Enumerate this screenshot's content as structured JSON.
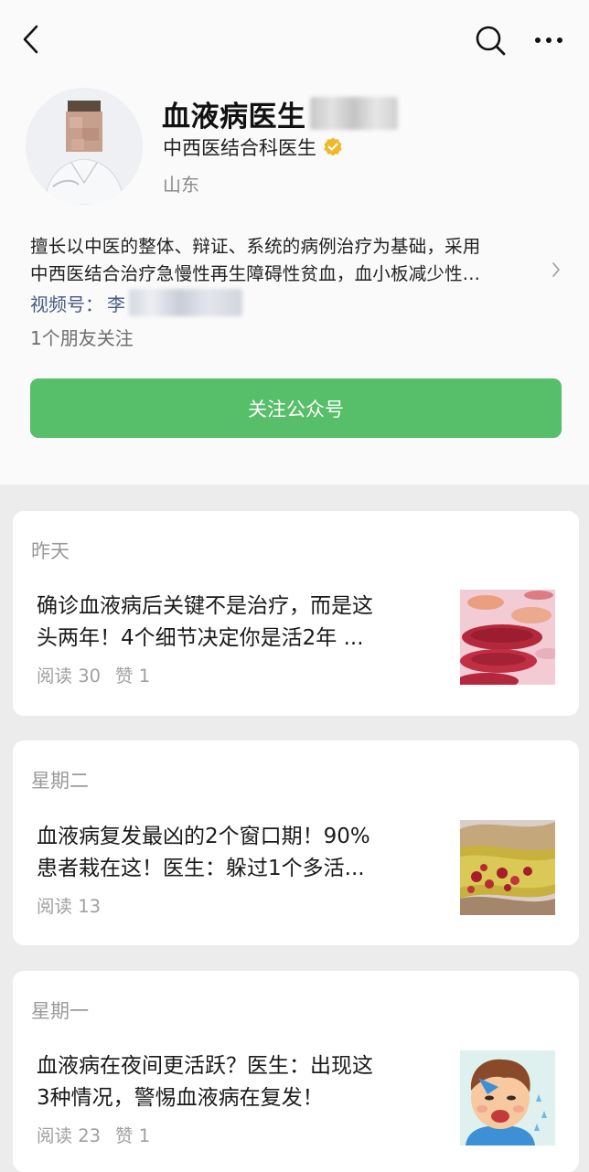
{
  "profile": {
    "name": "血液病医生",
    "verification": "中西医结合科医生",
    "location": "山东",
    "description_line1": "擅长以中医的整体、辩证、系统的病例治疗为基础，采用",
    "description_line2": "中西医结合治疗急慢性再生障碍性贫血，血小板减少性...",
    "channel_label": "视频号：",
    "channel_value": "李",
    "friends_following": "1个朋友关注",
    "follow_button": "关注公众号",
    "colors": {
      "follow_green": "#57be69",
      "verify_gold": "#f1b72b",
      "channel_blue": "#4a5a82"
    }
  },
  "icons": {
    "back": "chevron-left-icon",
    "search": "search-icon",
    "more": "more-dots-icon",
    "verify": "verified-badge-icon",
    "expand": "chevron-right-icon"
  },
  "articles": [
    {
      "date": "昨天",
      "title_line1": "确诊血液病后关键不是治疗，而是这",
      "title_line2": "头两年！4个细节决定你是活2年 ...",
      "reads": "阅读 30",
      "likes": "赞 1",
      "thumb": "red-blood-cells-image"
    },
    {
      "date": "星期二",
      "title_line1": "血液病复发最凶的2个窗口期！90%",
      "title_line2": "患者栽在这！医生：躲过1个多活...",
      "reads": "阅读 13",
      "likes": "",
      "thumb": "blood-vessel-plaque-image"
    },
    {
      "date": "星期一",
      "title_line1": "血液病在夜间更活跃？医生：出现这",
      "title_line2": "3种情况，警惕血液病在复发！",
      "reads": "阅读 23",
      "likes": "赞 1",
      "thumb": "sick-boy-cartoon-image"
    }
  ]
}
